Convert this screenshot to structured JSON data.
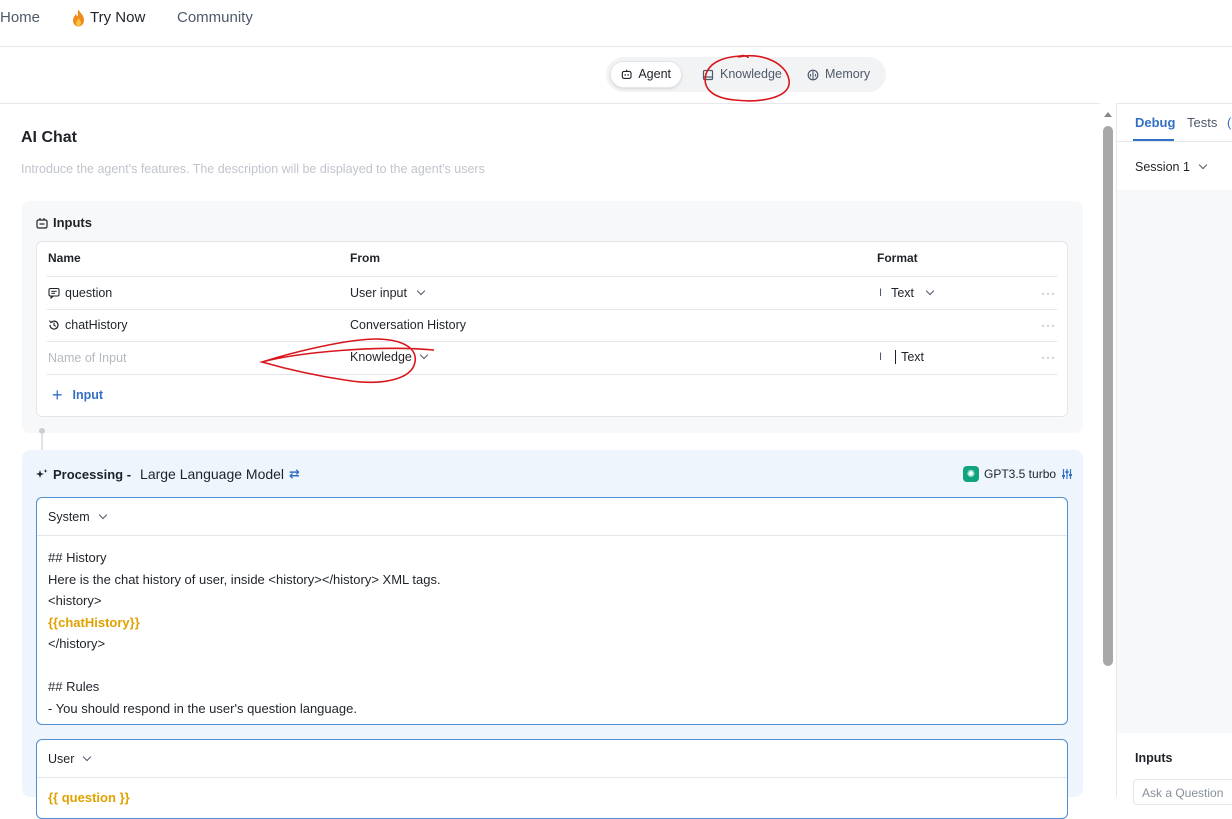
{
  "nav": {
    "home": "Home",
    "try_now": "Try Now",
    "community": "Community"
  },
  "modes": {
    "agent": "Agent",
    "knowledge": "Knowledge",
    "memory": "Memory",
    "active": "Agent"
  },
  "agent": {
    "title": "AI Chat",
    "description_placeholder": "Introduce the agent's features. The description will be displayed to the agent's users"
  },
  "inputs": {
    "heading": "Inputs",
    "columns": [
      "Name",
      "From",
      "Format"
    ],
    "rows": [
      {
        "name": "question",
        "from": "User input",
        "format": "Text",
        "more": "···"
      },
      {
        "name": "chatHistory",
        "from": "Conversation History",
        "format": "",
        "more": "···"
      },
      {
        "name_placeholder": "Name of Input",
        "from": "Knowledge",
        "format": "Text",
        "more": "···"
      }
    ],
    "add_label": "Input"
  },
  "processing": {
    "label": "Processing -",
    "model_kind": "Large Language Model",
    "model_name": "GPT3.5 turbo",
    "system_label": "System",
    "system_lines": [
      "## History",
      "Here is the chat history of user, inside <history></history> XML tags.",
      "<history>",
      "{{chatHistory}}",
      "</history>",
      "",
      "## Rules",
      "- You should respond in the user's question language."
    ],
    "user_label": "User",
    "user_text": "{{ question }}"
  },
  "right_panel": {
    "tabs": [
      "Debug",
      "Tests"
    ],
    "active_tab": "Debug",
    "session": "Session 1",
    "inputs_label": "Inputs",
    "ask_placeholder": "Ask a Question"
  },
  "colors": {
    "accent": "#3370c4",
    "variable": "#e0a200",
    "annotation": "#d9161c"
  }
}
